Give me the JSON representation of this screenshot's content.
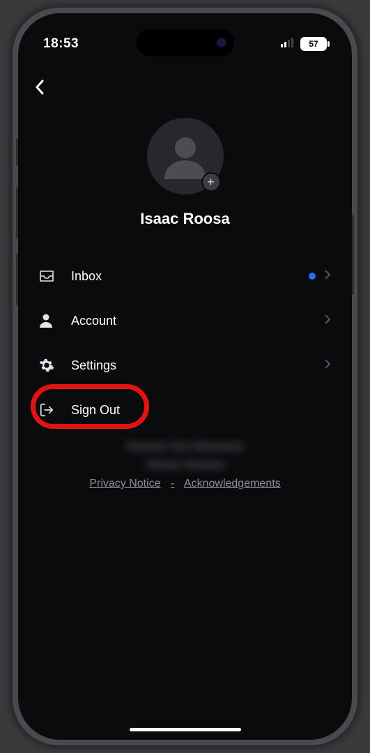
{
  "status": {
    "time": "18:53",
    "battery": "57"
  },
  "profile": {
    "name": "Isaac Roosa"
  },
  "menu": {
    "inbox": "Inbox",
    "account": "Account",
    "settings": "Settings",
    "sign_out": "Sign Out"
  },
  "inbox_has_badge": true,
  "footer": {
    "redacted_line1": "Xxxxxxx  Xxx   Xxxxxxxxx",
    "redacted_line2": "Xxxxxx  Xxxxxxx",
    "privacy": "Privacy Notice",
    "sep": "-",
    "ack": "Acknowledgements"
  },
  "highlighted_item": "sign_out"
}
